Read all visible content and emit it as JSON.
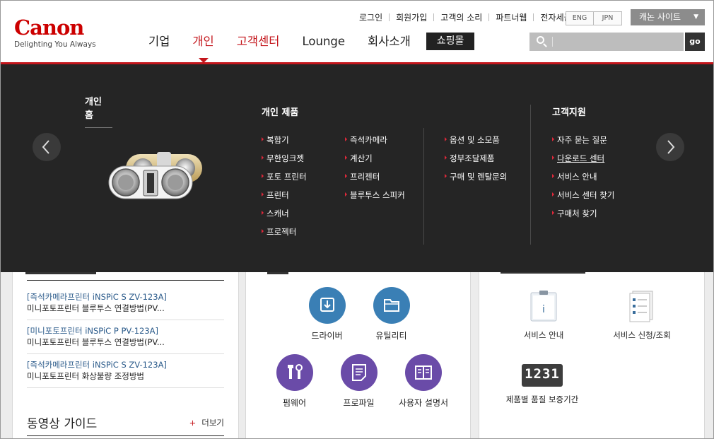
{
  "header": {
    "logo": "Canon",
    "tagline": "Delighting You Always",
    "util_links": [
      "로그인",
      "회원가입",
      "고객의 소리",
      "파트너웹",
      "전자세금"
    ],
    "lang": [
      "ENG",
      "JPN"
    ],
    "site_button": "캐논 사이트",
    "nav": [
      "기업",
      "개인",
      "고객센터",
      "Lounge",
      "회사소개"
    ],
    "shop_button": "쇼핑몰",
    "search_placeholder": "",
    "go_button": "go"
  },
  "mega": {
    "home": "개인 홈",
    "products_heading": "개인 제품",
    "products_col1": [
      "복합기",
      "무한잉크젯",
      "포토 프린터",
      "프린터",
      "스캐너",
      "프로젝터"
    ],
    "products_col2": [
      "즉석카메라",
      "계산기",
      "프리젠터",
      "블루투스 스피커"
    ],
    "products_col3": [
      "옵션 및 소모품",
      "정부조달제품",
      "구매 및 렌탈문의"
    ],
    "support_heading": "고객지원",
    "support_items": [
      "자주 묻는 질문",
      "다운로드 센터",
      "서비스 안내",
      "서비스 센터 찾기",
      "구매처 찾기"
    ]
  },
  "news": [
    {
      "title": "[즉석카메라프린터 iNSPiC S ZV-123A]",
      "desc": "미니포토프린터 블루투스 연결방법(PV..."
    },
    {
      "title": "[미니포토프린터 iNSPiC P PV-123A]",
      "desc": "미니포토프린터 블루투스 연결방법(PV..."
    },
    {
      "title": "[즉석카메라프린터 iNSPiC S ZV-123A]",
      "desc": "미니포토프린터 화상불량 조정방법"
    }
  ],
  "video": {
    "title": "동영상 가이드",
    "more": "더보기",
    "more_plus": "+"
  },
  "downloads": [
    "드라이버",
    "유틸리티",
    "펌웨어",
    "프로파일",
    "사용자 설명서"
  ],
  "services": [
    "서비스 안내",
    "서비스 신청/조회",
    "제품별 품질 보증기간"
  ],
  "warranty_digits": "1231",
  "colors": {
    "brand_red": "#c4161c",
    "menu_bg": "#252525",
    "teal": "#3a7fb5",
    "purple": "#6a4ba8"
  }
}
